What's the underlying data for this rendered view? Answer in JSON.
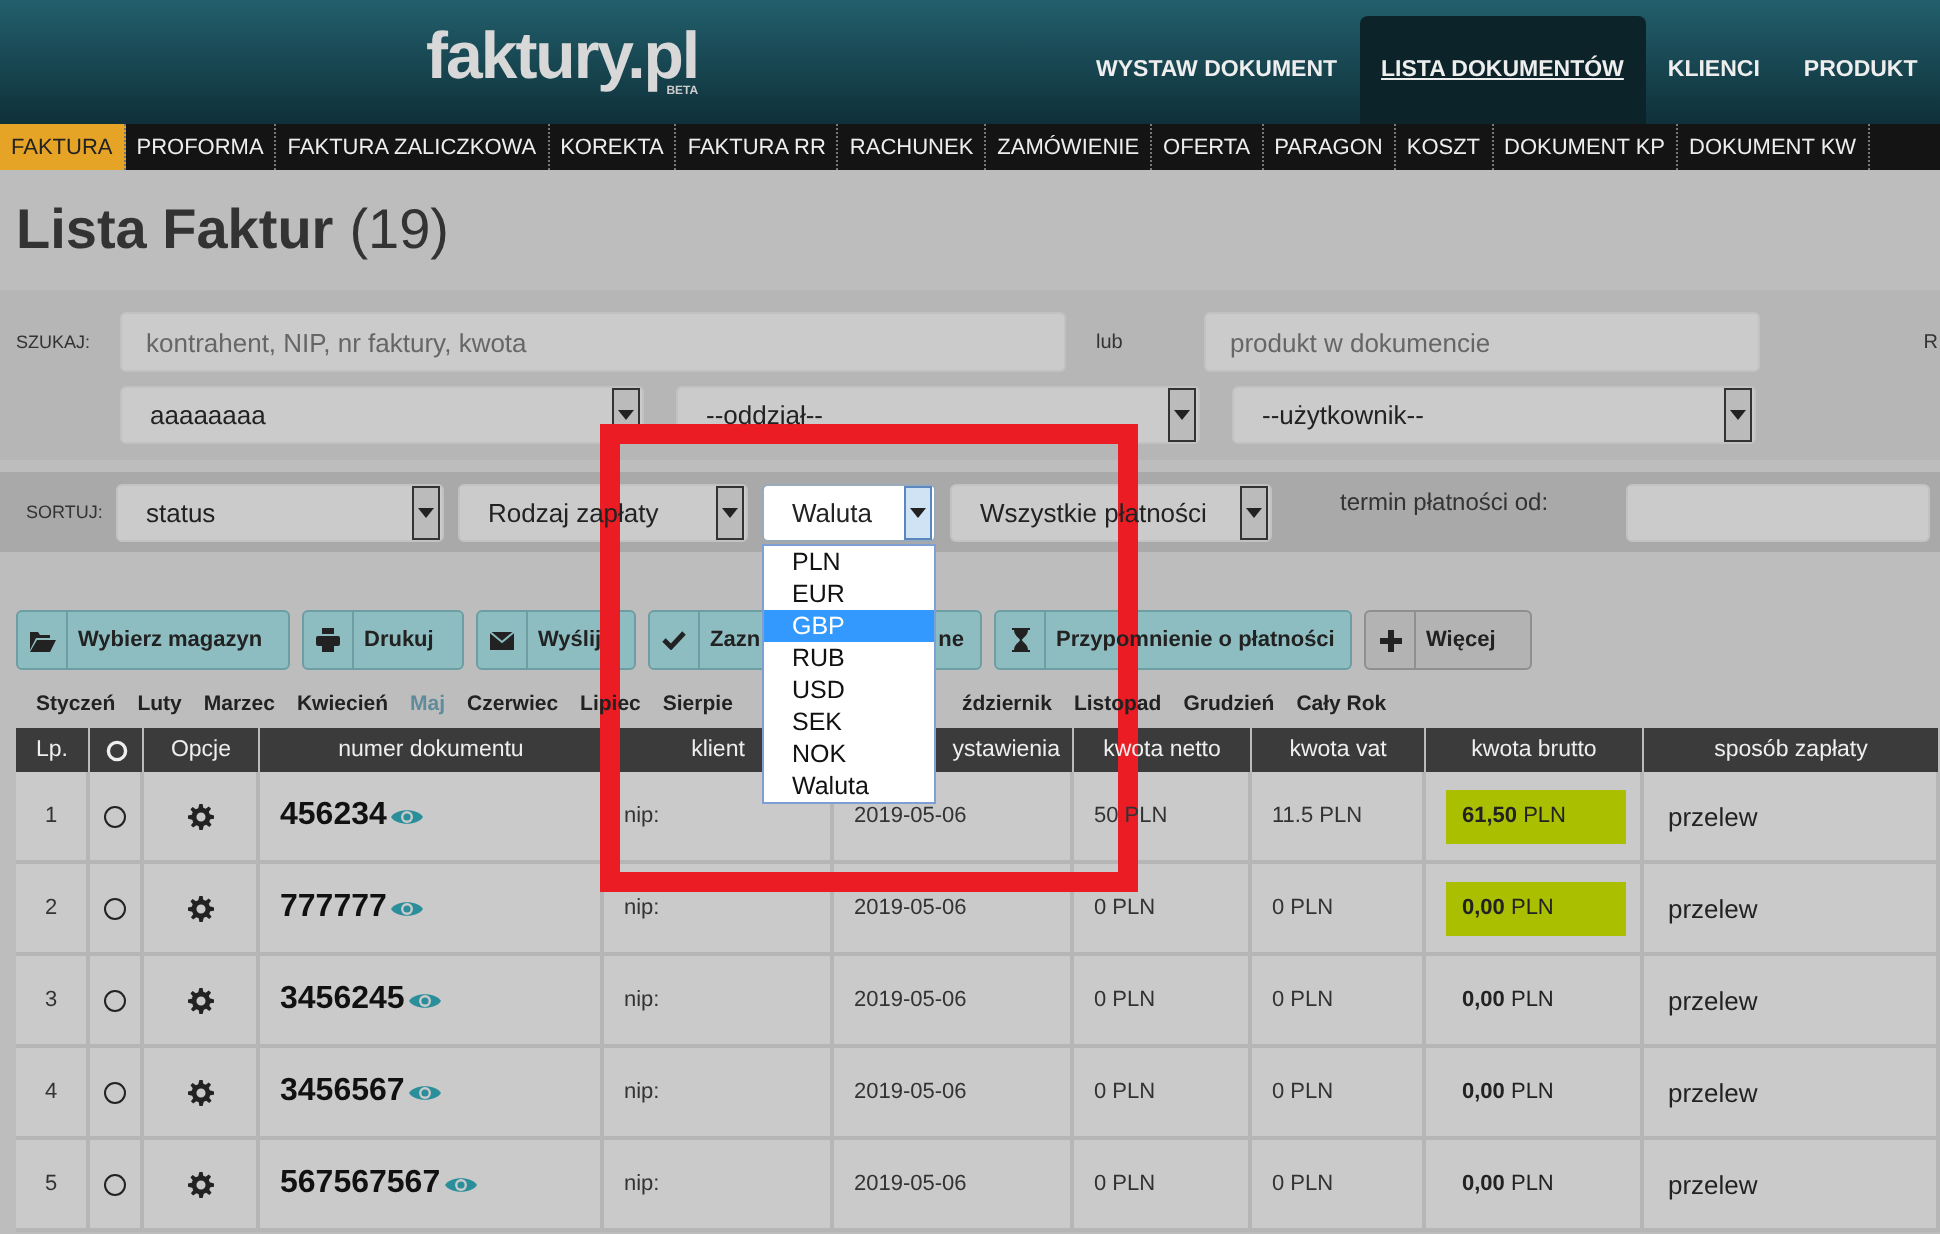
{
  "header": {
    "logo": "faktury.pl",
    "logo_badge": "BETA",
    "nav": [
      {
        "label": "WYSTAW DOKUMENT",
        "selected": false
      },
      {
        "label": "LISTA DOKUMENTÓW",
        "selected": true
      },
      {
        "label": "KLIENCI",
        "selected": false
      },
      {
        "label": "PRODUKT",
        "selected": false
      }
    ]
  },
  "document_types": [
    {
      "label": "FAKTURA",
      "selected": true
    },
    {
      "label": "PROFORMA",
      "selected": false
    },
    {
      "label": "FAKTURA ZALICZKOWA",
      "selected": false
    },
    {
      "label": "KOREKTA",
      "selected": false
    },
    {
      "label": "FAKTURA RR",
      "selected": false
    },
    {
      "label": "RACHUNEK",
      "selected": false
    },
    {
      "label": "ZAMÓWIENIE",
      "selected": false
    },
    {
      "label": "OFERTA",
      "selected": false
    },
    {
      "label": "PARAGON",
      "selected": false
    },
    {
      "label": "KOSZT",
      "selected": false
    },
    {
      "label": "DOKUMENT KP",
      "selected": false
    },
    {
      "label": "DOKUMENT KW",
      "selected": false
    }
  ],
  "page_title": {
    "text": "Lista Faktur",
    "count": "(19)"
  },
  "search": {
    "label": "SZUKAJ:",
    "query_placeholder": "kontrahent, NIP, nr faktury, kwota",
    "or_label": "lub",
    "product_placeholder": "produkt w dokumencie",
    "edge_label": "R",
    "selects": [
      "aaaaaaaa",
      "--oddział--",
      "--użytkownik--"
    ]
  },
  "sort": {
    "label": "SORTUJ:",
    "selects": [
      {
        "value": "status",
        "open": false
      },
      {
        "value": "Rodzaj zapłaty",
        "open": false
      },
      {
        "value": "Waluta",
        "open": true
      },
      {
        "value": "Wszystkie płatności",
        "open": false
      }
    ],
    "date_label": "termin płatności od:"
  },
  "currency_dropdown": {
    "options": [
      {
        "label": "PLN",
        "selected": false
      },
      {
        "label": "EUR",
        "selected": false
      },
      {
        "label": "GBP",
        "selected": true
      },
      {
        "label": "RUB",
        "selected": false
      },
      {
        "label": "USD",
        "selected": false
      },
      {
        "label": "SEK",
        "selected": false
      },
      {
        "label": "NOK",
        "selected": false
      },
      {
        "label": "Waluta",
        "selected": false
      }
    ]
  },
  "actions": [
    {
      "label": "Wybierz magazyn",
      "kind": "primary"
    },
    {
      "label": "Drukuj",
      "kind": "primary"
    },
    {
      "label": "Wyślij",
      "kind": "primary"
    },
    {
      "label": "Zazn",
      "label_end": "ne",
      "kind": "primary"
    },
    {
      "label": "Przypomnienie o płatności",
      "kind": "primary"
    },
    {
      "label": "Więcej",
      "kind": "secondary"
    }
  ],
  "months": [
    {
      "label": "Styczeń",
      "selected": false
    },
    {
      "label": "Luty",
      "selected": false
    },
    {
      "label": "Marzec",
      "selected": false
    },
    {
      "label": "Kwiecień",
      "selected": false
    },
    {
      "label": "Maj",
      "selected": true
    },
    {
      "label": "Czerwiec",
      "selected": false
    },
    {
      "label": "Lipiec",
      "selected": false
    },
    {
      "label": "Sierpie",
      "selected": false
    },
    {
      "label": "ździernik",
      "selected": false
    },
    {
      "label": "Listopad",
      "selected": false
    },
    {
      "label": "Grudzień",
      "selected": false
    },
    {
      "label": "Cały Rok",
      "selected": false
    }
  ],
  "table": {
    "columns": [
      {
        "kind": "text",
        "label": "Lp.",
        "partly_hidden": false
      },
      {
        "kind": "icon",
        "partly_hidden": false
      },
      {
        "kind": "text",
        "label": "Opcje",
        "partly_hidden": false
      },
      {
        "kind": "text",
        "label": "numer dokumentu",
        "partly_hidden": false
      },
      {
        "kind": "text",
        "label": "klient",
        "partly_hidden": false
      },
      {
        "kind": "text",
        "label": "ystawienia",
        "partly_hidden": true
      },
      {
        "kind": "text",
        "label": "kwota netto",
        "partly_hidden": false
      },
      {
        "kind": "text",
        "label": "kwota vat",
        "partly_hidden": false
      },
      {
        "kind": "text",
        "label": "kwota brutto",
        "partly_hidden": false
      },
      {
        "kind": "text",
        "label": "sposób zapłaty",
        "partly_hidden": false
      }
    ],
    "rows": [
      {
        "lp": "1",
        "selected": false,
        "number": "456234",
        "client": "nip:",
        "date": "2019-05-06",
        "net": "50 PLN",
        "vat": "11.5 PLN",
        "gross": "**61,50** PLN",
        "gross_highlighted": true,
        "payment": "przelew"
      },
      {
        "lp": "2",
        "selected": false,
        "number": "777777",
        "client": "nip:",
        "date": "2019-05-06",
        "net": "0 PLN",
        "vat": "0 PLN",
        "gross": "**0,00** PLN",
        "gross_highlighted": true,
        "payment": "przelew"
      },
      {
        "lp": "3",
        "selected": false,
        "number": "3456245",
        "client": "nip:",
        "date": "2019-05-06",
        "net": "0 PLN",
        "vat": "0 PLN",
        "gross": "**0,00** PLN",
        "gross_highlighted": false,
        "payment": "przelew"
      },
      {
        "lp": "4",
        "selected": false,
        "number": "3456567",
        "client": "nip:",
        "date": "2019-05-06",
        "net": "0 PLN",
        "vat": "0 PLN",
        "gross": "**0,00** PLN",
        "gross_highlighted": false,
        "payment": "przelew"
      },
      {
        "lp": "5",
        "selected": false,
        "number": "567567567",
        "client": "nip:",
        "date": "2019-05-06",
        "net": "0 PLN",
        "vat": "0 PLN",
        "gross": "**0,00** PLN",
        "gross_highlighted": false,
        "payment": "przelew"
      }
    ]
  }
}
